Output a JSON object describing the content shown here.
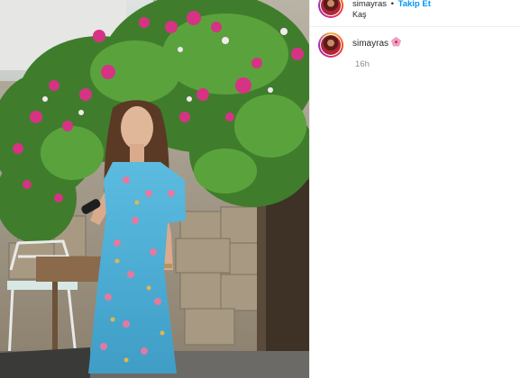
{
  "post": {
    "username": "simayras",
    "separator": "•",
    "follow_label": "Takip Et",
    "location": "Kaş"
  },
  "caption": {
    "username": "simayras",
    "emoji_icon": "cherry-blossom-icon",
    "time": "16h"
  },
  "colors": {
    "follow_blue": "#0095f6",
    "text": "#262626",
    "muted": "#8e8e8e",
    "dress": "#4fb0d6"
  }
}
